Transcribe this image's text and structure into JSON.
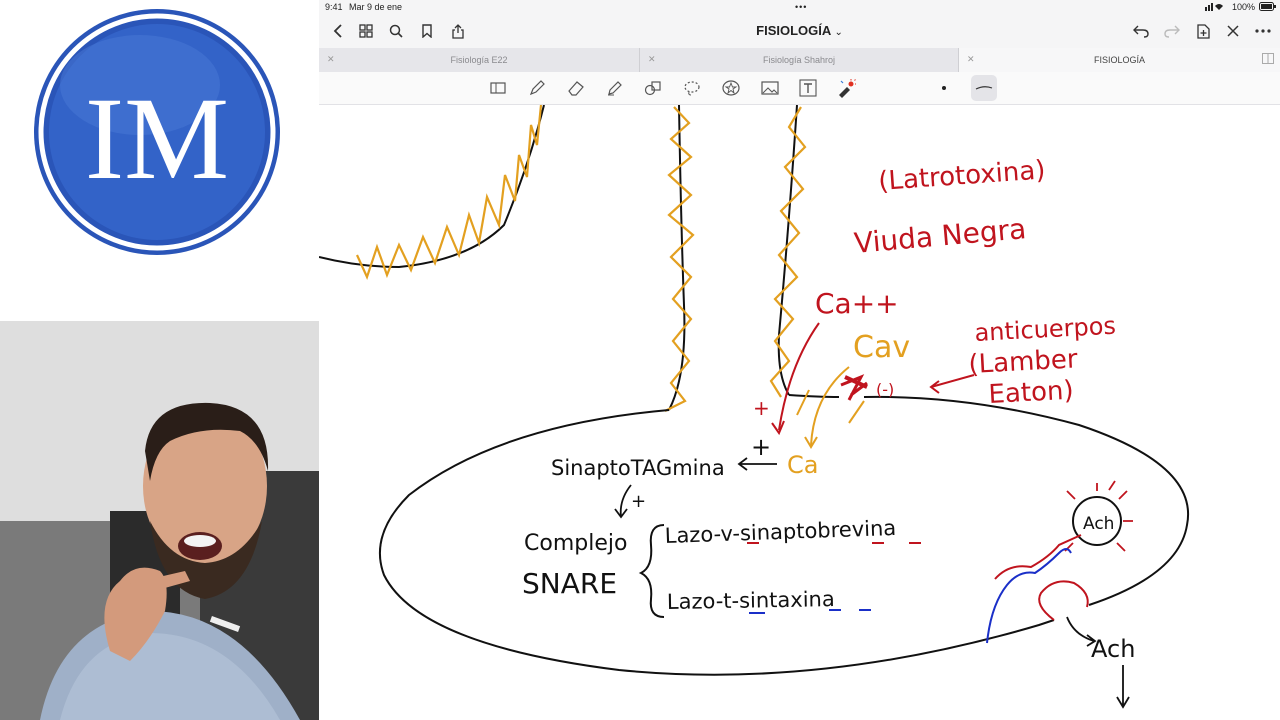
{
  "status": {
    "time": "9:41",
    "date": "Mar 9 de ene",
    "battery": "100%"
  },
  "logo": {
    "letters": "IM",
    "colors": {
      "ring": "#2a55b8",
      "inner": "#2f5fc4"
    }
  },
  "navbar": {
    "title": "FISIOLOGÍA",
    "title_chevron": "⌄"
  },
  "tabs": [
    {
      "label": "Fisiología E22",
      "active": false
    },
    {
      "label": "Fisiología Shahroj",
      "active": false
    },
    {
      "label": "FISIOLOGÍA",
      "active": true
    }
  ],
  "toolbar": {
    "tools": [
      "layout-icon",
      "pen-icon",
      "eraser-icon",
      "highlighter-icon",
      "shapes-icon",
      "lasso-icon",
      "sticker-icon",
      "image-icon",
      "text-icon",
      "laser-pointer-icon"
    ],
    "selected_option": "thin-line"
  },
  "notes": {
    "latrotoxina": "(Latrotoxina)",
    "viuda_negra": "Viuda Negra",
    "ca_plus_red": "Ca++",
    "ca_v": "Cav",
    "anticuerpos": "anticuerpos",
    "lamber": "(Lamber",
    "eaton": "Eaton)",
    "minus": "(-)",
    "plus_left": "+",
    "plus_mid": "+",
    "sinaptotagmina": "SinaptoTAGmina",
    "ca_orange": "Ca",
    "plus_arrow": "+",
    "complejo": "Complejo",
    "snare": "SNARE",
    "lazo_v": "Lazo-v-sinaptobrevina",
    "lazo_t": "Lazo-t-sintaxina",
    "ach_circle": "Ach",
    "ach_out": "Ach"
  },
  "colors": {
    "red": "#c0141e",
    "orange": "#e3a020",
    "blue": "#1a2fc8",
    "ink": "#111111"
  }
}
